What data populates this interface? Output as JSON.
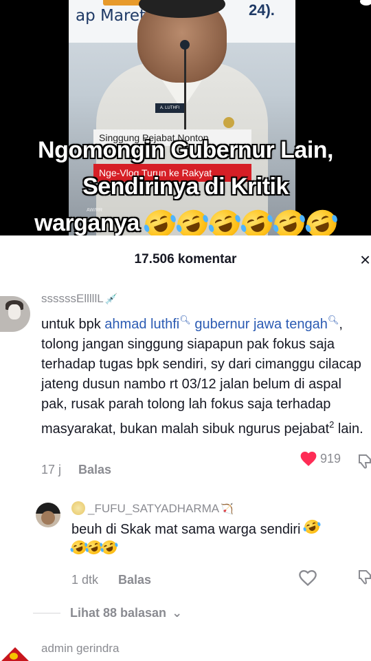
{
  "video": {
    "banner_left": "ap Maret",
    "banner_right": "24).",
    "nametag": "A. LUTHFI",
    "lower_third_1": "Singgung Pejabat Nonton",
    "lower_third_2": "Nge-Vlog Turun ke Rakyat",
    "watermark": "AW/RR",
    "caption_line1": "Ngomongin Gubernur Lain,",
    "caption_line2": "Sendirinya di Kritik",
    "caption_line3": "warganya",
    "caption_emoji": "rolling-on-floor-laughing"
  },
  "comments_panel": {
    "count_label": "17.506 komentar",
    "close_label": "×"
  },
  "comment_1": {
    "username": "ssssssElllllL",
    "text_before": "untuk bpk ",
    "mention_1": "ahmad luthfi",
    "mention_2": "gubernur jawa tengah",
    "text_after": ", tolong jangan singgung siapapun pak fokus saja terhadap tugas bpk sendiri, sy dari cimanggu cilacap jateng dusun nambo rt 03/12 jalan belum di aspal pak, rusak parah tolong lah fokus saja terhadap masyarakat, bukan malah sibuk ngurus pejabat",
    "superscript": "2",
    "text_end": " lain.",
    "time": "17 j",
    "reply_label": "Balas",
    "likes": "919"
  },
  "reply_1": {
    "username": "_FUFU_SATYADHARMA",
    "text": "beuh di Skak mat sama warga sendiri",
    "time": "1 dtk",
    "reply_label": "Balas"
  },
  "view_replies": {
    "label": "Lihat 88 balasan",
    "chevron": "⌄"
  },
  "comment_2": {
    "username": "admin gerindra"
  },
  "colors": {
    "like_red": "#fe2c55",
    "mention_blue": "#2b5bb3",
    "muted_gray": "#8a8b91"
  }
}
